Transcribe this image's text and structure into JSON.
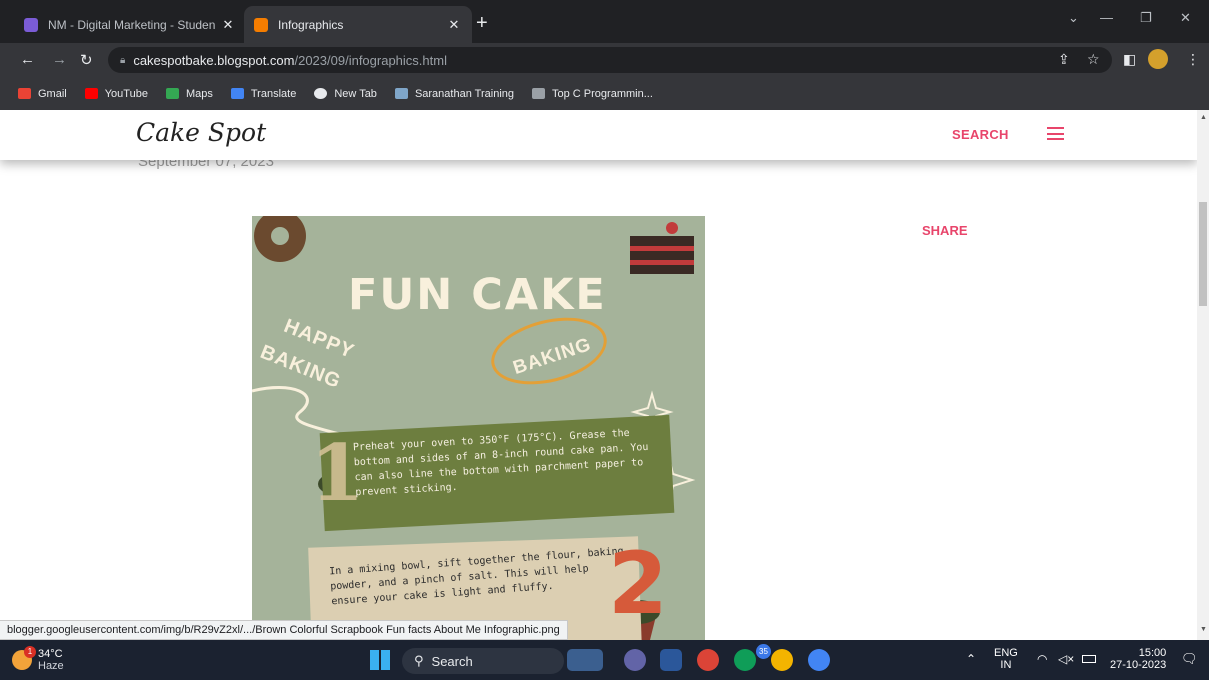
{
  "browser": {
    "tabs": [
      {
        "title": "NM - Digital Marketing - Studen",
        "active": false
      },
      {
        "title": "Infographics",
        "active": true
      }
    ],
    "new_tab": "+",
    "url_host": "cakespotbake.blogspot.com",
    "url_path": "/2023/09/infographics.html",
    "bookmarks": [
      "Gmail",
      "YouTube",
      "Maps",
      "Translate",
      "New Tab",
      "Saranathan Training",
      "Top C Programmin..."
    ]
  },
  "blog": {
    "title": "Cake Spot",
    "search_label": "SEARCH",
    "date_peek": "September 07, 2023",
    "share_label": "SHARE"
  },
  "infographic": {
    "title": "FUN CAKE",
    "happy": "HAPPY",
    "baking_left": "BAKING",
    "baking_oval": "BAKING",
    "step1_number": "1",
    "step1_text": "Preheat your oven to 350°F (175°C). Grease the bottom and sides of an 8-inch round cake pan. You can also line the bottom with parchment paper to prevent sticking.",
    "step2_number": "2",
    "step2_text": "In a mixing bowl, sift together the flour, baking powder, and a pinch of salt. This will help ensure your cake is light and fluffy."
  },
  "status_url": "blogger.googleusercontent.com/img/b/R29vZ2xl/.../Brown Colorful Scrapbook Fun facts About Me Infographic.png",
  "taskbar": {
    "temperature": "34°C",
    "condition": "Haze",
    "weather_badge": "1",
    "search_label": "Search",
    "chrome_badge": "35",
    "language": "ENG",
    "region": "IN",
    "time": "15:00",
    "date": "27-10-2023"
  },
  "colors": {
    "accent": "#e8456b",
    "infographic_bg": "#a5b39a",
    "taskbar_bg": "#1b2230",
    "chrome_dark": "#202124"
  }
}
